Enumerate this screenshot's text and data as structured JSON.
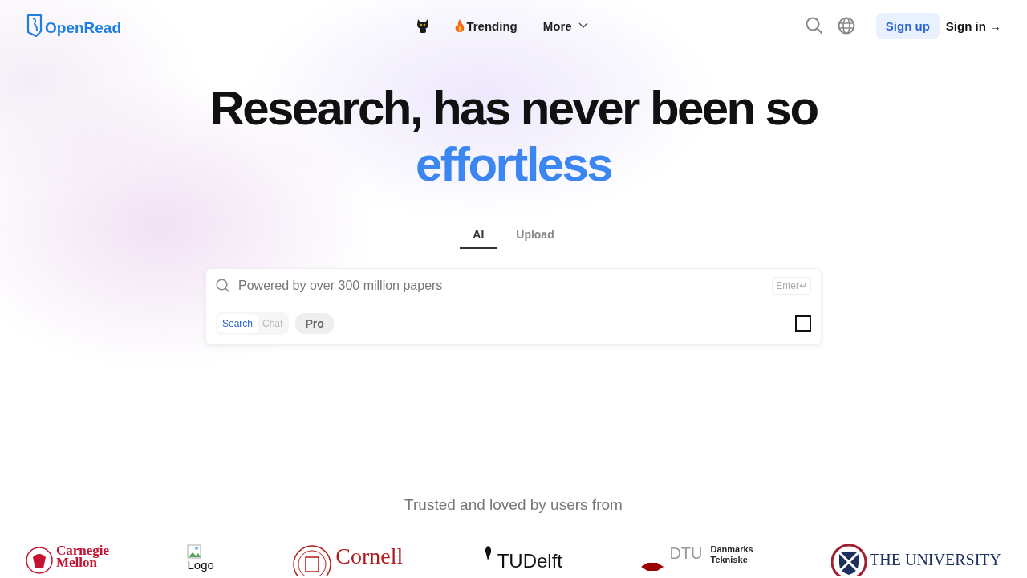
{
  "header": {
    "logo": "OpenRead",
    "nav": [
      {
        "kind": "mascot"
      },
      {
        "kind": "trending",
        "label": "Trending"
      },
      {
        "kind": "menu",
        "label": "More"
      }
    ],
    "sign_up": "Sign up",
    "sign_in": "Sign in →"
  },
  "hero": {
    "title": "Research, has never been so",
    "highlight": "effortless"
  },
  "tabs": [
    {
      "label": "AI",
      "selected": true
    },
    {
      "label": "Upload",
      "selected": false
    }
  ],
  "search": {
    "placeholder": "Powered by over 300 million papers",
    "enter_hint": "Enter↵",
    "modes": [
      {
        "label": "Search",
        "selected": true
      },
      {
        "label": "Chat",
        "selected": false
      }
    ],
    "pro": "Pro",
    "option_checked": false
  },
  "trusted": {
    "title": "Trusted and loved by users from",
    "logos": [
      {
        "kind": "cmu",
        "lines": [
          "Carnegie",
          "Mellon"
        ]
      },
      {
        "kind": "broken",
        "lines": [
          "Logo"
        ]
      },
      {
        "kind": "cornell",
        "lines": [
          "Cornell"
        ]
      },
      {
        "kind": "tudelft",
        "lines": [
          "TUDelft"
        ]
      },
      {
        "kind": "dtu",
        "lines": [
          "DTU",
          "Danmarks",
          "Tekniske"
        ]
      },
      {
        "kind": "edinburgh",
        "lines": [
          "THE UNIVERSITY"
        ]
      }
    ]
  }
}
